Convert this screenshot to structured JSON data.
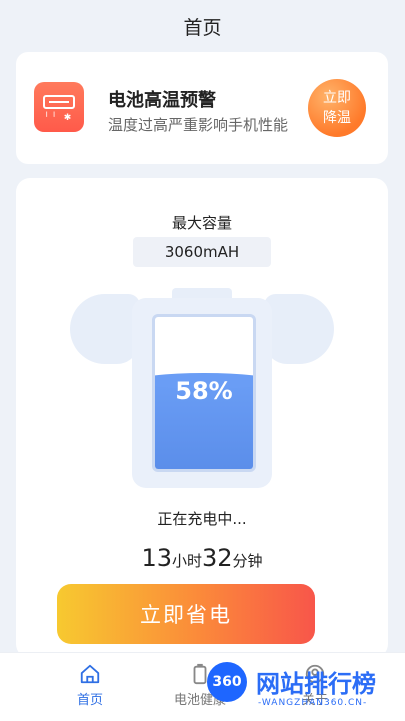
{
  "header": {
    "title": "首页"
  },
  "alert": {
    "title": "电池高温预警",
    "subtitle": "温度过高严重影响手机性能",
    "button_line1": "立即",
    "button_line2": "降温",
    "icon": "air-conditioner-icon"
  },
  "battery": {
    "capacity_label": "最大容量",
    "capacity_value": "3060mAH",
    "percent_text": "58%",
    "level": 0.58,
    "status": "正在充电中...",
    "remaining": {
      "hours": "13",
      "hours_unit": "小时",
      "minutes": "32",
      "minutes_unit": "分钟"
    }
  },
  "save_button": {
    "label": "立即省电"
  },
  "tabs": [
    {
      "label": "首页",
      "icon": "home-icon",
      "active": true
    },
    {
      "label": "电池健康",
      "icon": "battery-icon",
      "active": false
    },
    {
      "label": "关于",
      "icon": "user-icon",
      "active": false
    }
  ],
  "watermark": {
    "badge": "360",
    "text": "网站排行榜",
    "url": "-WANGZHAN360.CN-"
  },
  "colors": {
    "accent": "#2f6fe4",
    "battery_fill": "#6a9df5",
    "alert": "#ff5a4a"
  }
}
